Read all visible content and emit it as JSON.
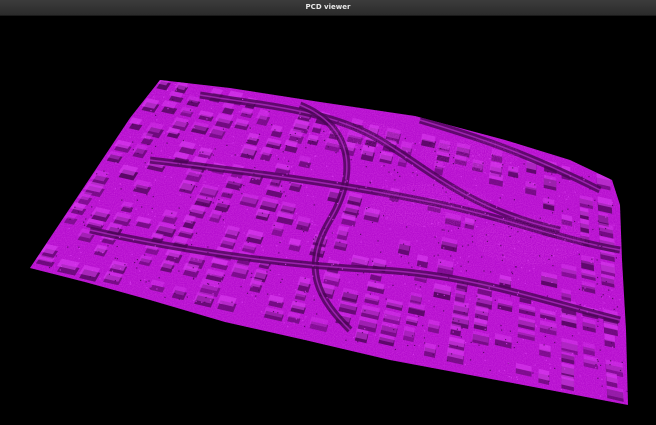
{
  "window": {
    "title": "PCD viewer"
  },
  "viewer": {
    "background_color": "#000000",
    "point_color": "#b60fcf",
    "highlight_color": "#d93cf0",
    "shadow_color": "#4a0555",
    "content": "point-cloud-city-terrain"
  }
}
